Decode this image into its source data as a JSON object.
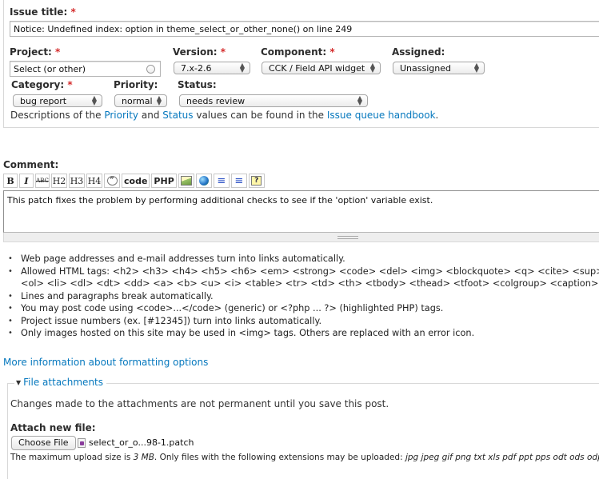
{
  "issue_title": {
    "label": "Issue title:",
    "required_mark": "*",
    "value": "Notice: Undefined index: option in theme_select_or_other_none() on line 249"
  },
  "project": {
    "label": "Project:",
    "required_mark": "*",
    "value": "Select (or other)"
  },
  "version": {
    "label": "Version:",
    "required_mark": "*",
    "value": "7.x-2.6"
  },
  "component": {
    "label": "Component:",
    "required_mark": "*",
    "value": "CCK / Field API widget"
  },
  "assigned": {
    "label": "Assigned:",
    "value": "Unassigned"
  },
  "category": {
    "label": "Category:",
    "required_mark": "*",
    "value": "bug report"
  },
  "priority": {
    "label": "Priority:",
    "value": "normal"
  },
  "status": {
    "label": "Status:",
    "value": "needs review"
  },
  "descriptions": {
    "prefix": "Descriptions of the",
    "priority_link": "Priority",
    "and": "and",
    "status_link": "Status",
    "middle": "values can be found in the",
    "handbook_link": "Issue queue handbook",
    "suffix": "."
  },
  "comment": {
    "label": "Comment:",
    "toolbar": [
      {
        "name": "bold",
        "label": "B"
      },
      {
        "name": "italic",
        "label": "I"
      },
      {
        "name": "strikethrough",
        "label": "ABC"
      },
      {
        "name": "h2",
        "label": "H2"
      },
      {
        "name": "h3",
        "label": "H3"
      },
      {
        "name": "h4",
        "label": "H4"
      },
      {
        "name": "quote",
        "label": "”"
      },
      {
        "name": "code",
        "label": "code"
      },
      {
        "name": "php",
        "label": "PHP"
      },
      {
        "name": "image",
        "label": ""
      },
      {
        "name": "link",
        "label": ""
      },
      {
        "name": "ordered-list",
        "label": ""
      },
      {
        "name": "unordered-list",
        "label": ""
      },
      {
        "name": "help",
        "label": "?"
      }
    ],
    "value": "This patch fixes the problem by performing additional checks to see if the 'option' variable exist."
  },
  "tips": [
    "Web page addresses and e-mail addresses turn into links automatically.",
    "Allowed HTML tags: <h2> <h3> <h4> <h5> <h6> <em> <strong> <code> <del> <img> <blockquote> <q> <cite> <sup> <sub> <p> <br> <ul>",
    "<ol> <li> <dl> <dt> <dd> <a> <b> <u> <i> <table> <tr> <td> <th> <tbody> <thead> <tfoot> <colgroup> <caption>",
    "Lines and paragraphs break automatically.",
    "You may post code using <code>...</code> (generic) or <?php ... ?> (highlighted PHP) tags.",
    "Project issue numbers (ex. [#12345]) turn into links automatically.",
    "Only images hosted on this site may be used in <img> tags. Others are replaced with an error icon."
  ],
  "more_info_link": "More information about formatting options",
  "file_attachments": {
    "legend": "File attachments",
    "notice": "Changes made to the attachments are not permanent until you save this post.",
    "attach_label": "Attach new file:",
    "choose_button": "Choose File",
    "file_name": "select_or_o...98-1.patch",
    "limits_prefix": "The maximum upload size is",
    "max_size": "3 MB",
    "limits_middle": ". Only files with the following extensions may be uploaded:",
    "extensions": "jpg jpeg gif png txt xls pdf ppt pps odt ods odp gz tgz patch diff zip"
  },
  "colors": {
    "link": "#0678be",
    "required": "#d42b2b",
    "text": "#3b3b3b"
  }
}
